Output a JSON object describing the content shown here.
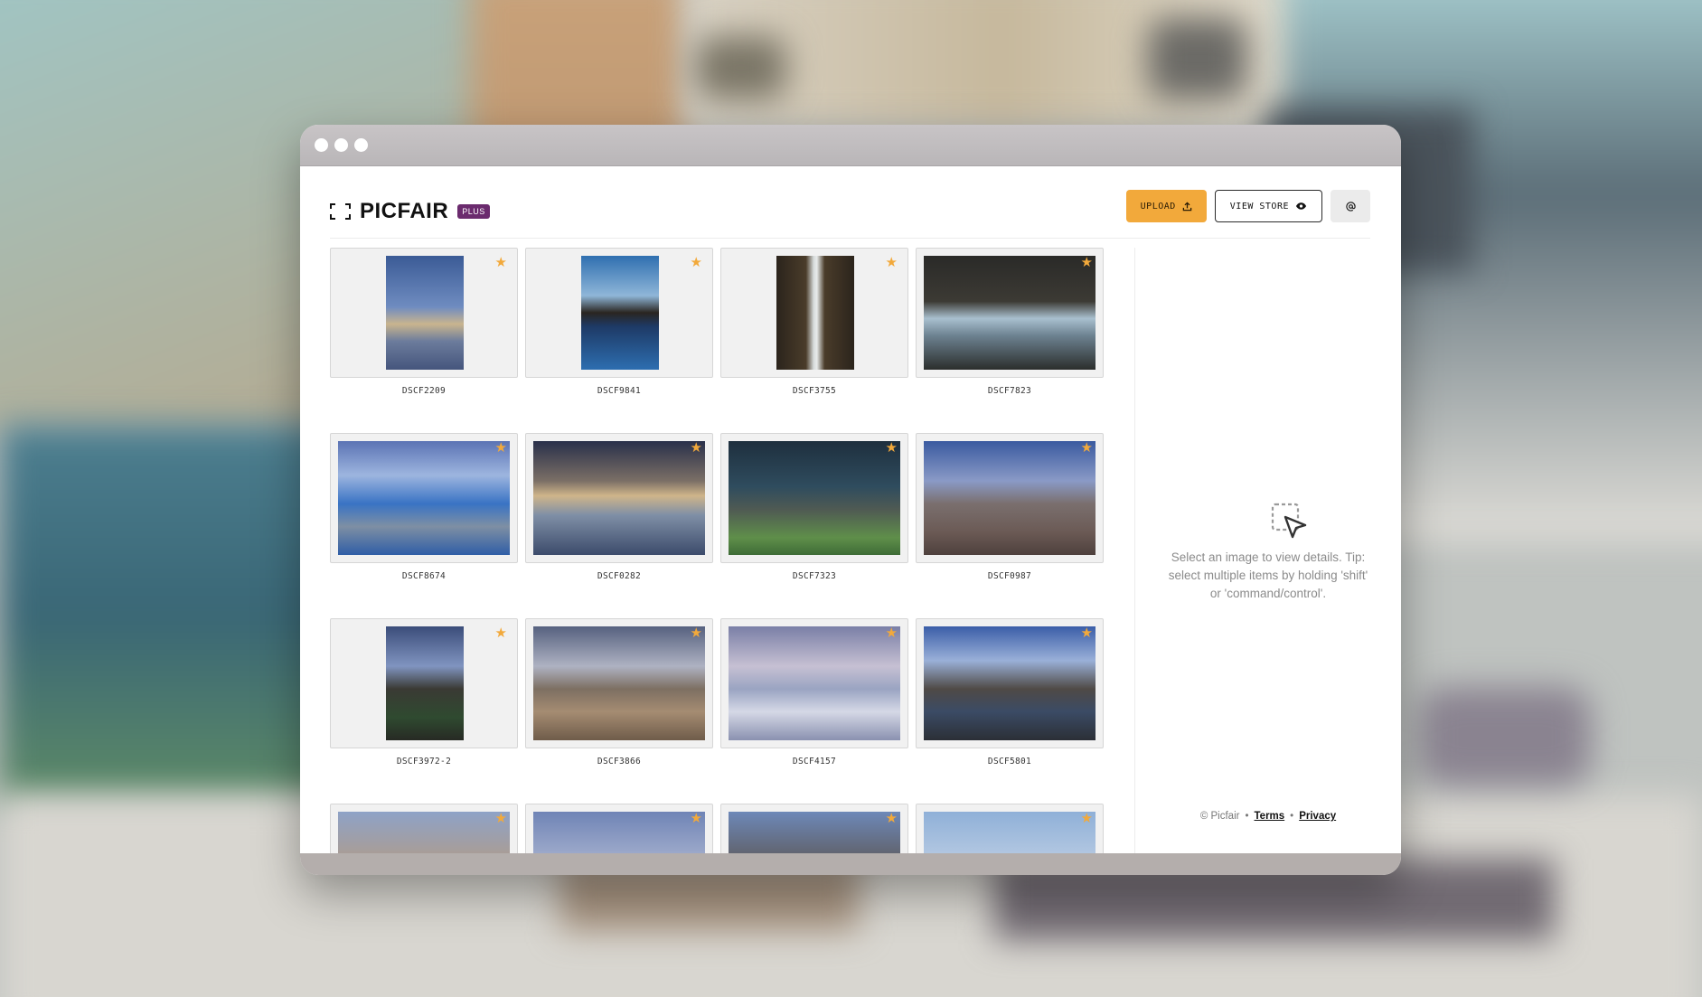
{
  "app": {
    "name": "PICFAIR",
    "badge": "PLUS"
  },
  "header": {
    "upload_label": "UPLOAD",
    "view_store_label": "VIEW STORE",
    "user_icon": "at-icon"
  },
  "photos": [
    {
      "name": "DSCF2209",
      "starred": true,
      "orientation": "portrait"
    },
    {
      "name": "DSCF9841",
      "starred": true,
      "orientation": "portrait"
    },
    {
      "name": "DSCF3755",
      "starred": true,
      "orientation": "portrait"
    },
    {
      "name": "DSCF7823",
      "starred": true,
      "orientation": "landscape"
    },
    {
      "name": "DSCF8674",
      "starred": true,
      "orientation": "landscape"
    },
    {
      "name": "DSCF0282",
      "starred": true,
      "orientation": "landscape"
    },
    {
      "name": "DSCF7323",
      "starred": true,
      "orientation": "landscape"
    },
    {
      "name": "DSCF0987",
      "starred": true,
      "orientation": "landscape"
    },
    {
      "name": "DSCF3972-2",
      "starred": true,
      "orientation": "portrait"
    },
    {
      "name": "DSCF3866",
      "starred": true,
      "orientation": "landscape"
    },
    {
      "name": "DSCF4157",
      "starred": true,
      "orientation": "landscape"
    },
    {
      "name": "DSCF5801",
      "starred": true,
      "orientation": "landscape"
    },
    {
      "name": "",
      "starred": true,
      "orientation": "landscape"
    },
    {
      "name": "",
      "starred": true,
      "orientation": "landscape"
    },
    {
      "name": "",
      "starred": true,
      "orientation": "landscape"
    },
    {
      "name": "",
      "starred": true,
      "orientation": "landscape"
    }
  ],
  "sidebar": {
    "tip": "Select an image to view details. Tip: select multiple items by holding 'shift' or 'command/control'.",
    "footer": {
      "copyright": "© Picfair",
      "terms": "Terms",
      "privacy": "Privacy"
    }
  },
  "colors": {
    "accent": "#f2a93b",
    "badge": "#6b2b6e"
  }
}
